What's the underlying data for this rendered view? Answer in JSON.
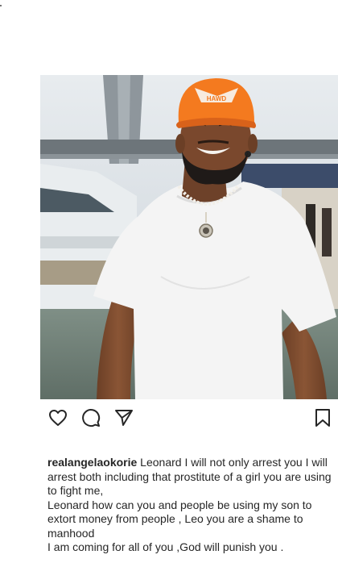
{
  "post": {
    "username": "realangelaokorie",
    "caption_first": "Leonard I will not only arrest you I will arrest both including that prostitute of a girl you are using to fight me,",
    "caption_second": "Leonard how can you and people be using my son to extort money from people , Leo you are a shame to manhood",
    "caption_third": "I am coming for all of you ,God will punish you .",
    "cap_text": "HAWD"
  },
  "icons": {
    "like": "heart-icon",
    "comment": "comment-icon",
    "share": "send-icon",
    "save": "bookmark-icon"
  },
  "colors": {
    "cap": "#f47a1f",
    "shirt": "#f4f4f4",
    "text": "#262626"
  }
}
